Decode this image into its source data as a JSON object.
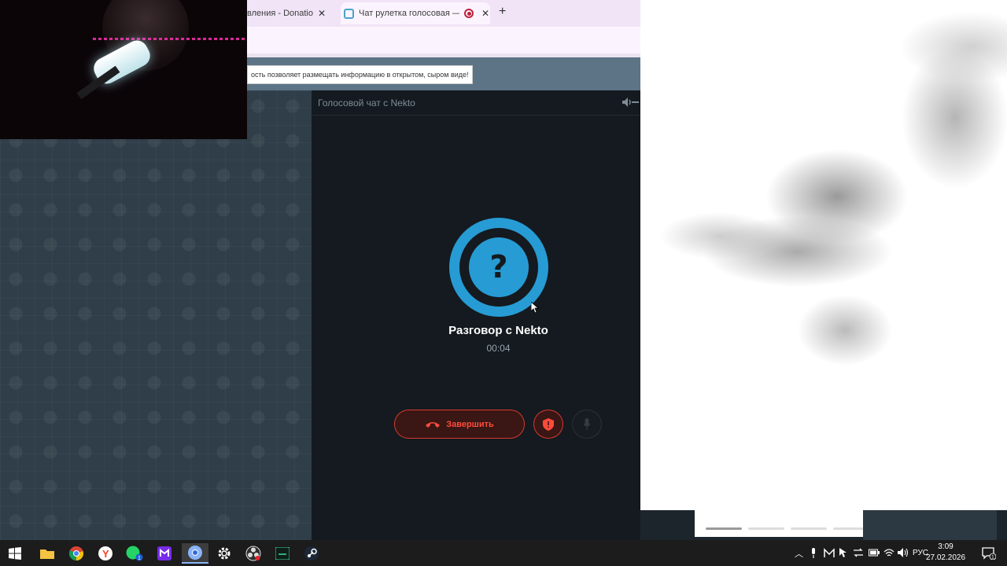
{
  "browser": {
    "tabs": [
      {
        "title": "вления - Donatio",
        "active": false
      },
      {
        "title": "Чат рулетка голосовая — ",
        "active": true
      }
    ]
  },
  "site": {
    "notice": "ость позволяет размещать информацию в открытом, сыром виде!"
  },
  "chat": {
    "header_title": "Голосовой чат с Nekto",
    "avatar_glyph": "?",
    "conversation_title": "Разговор с Nekto",
    "timer": "00:04",
    "end_button_label": "Завершить"
  },
  "taskbar": {
    "apps": [
      "start-icon",
      "file-explorer-icon",
      "chrome-icon",
      "yandex-browser-icon",
      "whatsapp-icon",
      "twitch-studio-icon",
      "chrome-icon",
      "settings-icon",
      "obs-icon",
      "terminal-icon",
      "steam-icon"
    ],
    "whatsapp_badge": "1",
    "language": "РУС",
    "time": "3:09",
    "date": "27.02.2026",
    "notification_count": "1"
  },
  "colors": {
    "accent_blue": "#279bd4",
    "danger_red": "#d63a2f",
    "panel_bg": "#141a1f"
  }
}
